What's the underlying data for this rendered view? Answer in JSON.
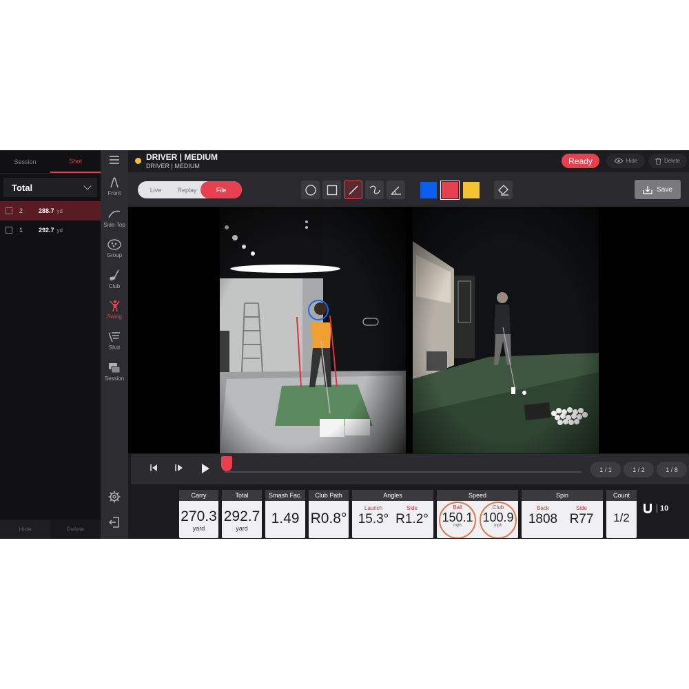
{
  "left_panel": {
    "tabs": [
      "Session",
      "Shot"
    ],
    "active_tab": "Shot",
    "filter": "Total",
    "shots": [
      {
        "num": "2",
        "value": "288.7",
        "unit": "yd",
        "selected": true
      },
      {
        "num": "1",
        "value": "292.7",
        "unit": "yd",
        "selected": false
      }
    ],
    "hide_label": "Hide",
    "delete_label": "Delete"
  },
  "nav": {
    "items": [
      {
        "label": "Front",
        "icon": "front-view-icon"
      },
      {
        "label": "Side-Top",
        "icon": "side-top-view-icon"
      },
      {
        "label": "Group",
        "icon": "group-icon"
      },
      {
        "label": "Club",
        "icon": "club-icon"
      },
      {
        "label": "Swing",
        "icon": "swing-icon",
        "active": true
      },
      {
        "label": "Shot",
        "icon": "shot-icon"
      },
      {
        "label": "Session",
        "icon": "session-icon"
      }
    ]
  },
  "header": {
    "title": "DRIVER | MEDIUM",
    "subtitle": "DRIVER | MEDIUM",
    "status": "Ready",
    "hide_label": "Hide",
    "delete_label": "Delete"
  },
  "toolbar": {
    "modes": [
      "Live",
      "Replay",
      "File"
    ],
    "active_mode": "File",
    "tools": [
      "circle-tool-icon",
      "rectangle-tool-icon",
      "line-tool-icon",
      "curve-tool-icon",
      "angle-tool-icon",
      "eraser-icon"
    ],
    "active_tool": "line-tool-icon",
    "colors": [
      "#0a5ef0",
      "#e8404f",
      "#f3c230"
    ],
    "selected_color": "#e8404f",
    "save_label": "Save"
  },
  "timeline": {
    "pages": [
      "1 / 1",
      "1 / 2",
      "1 / 8"
    ]
  },
  "stats": {
    "carry": {
      "label": "Carry",
      "value": "270.3",
      "unit": "yard"
    },
    "total": {
      "label": "Total",
      "value": "292.7",
      "unit": "yard"
    },
    "smash": {
      "label": "Smash Fac.",
      "value": "1.49"
    },
    "club_path": {
      "label": "Club Path",
      "value": "R0.8°"
    },
    "angles": {
      "label": "Angles",
      "launch_label": "Launch",
      "launch": "15.3°",
      "side_label": "Side",
      "side": "R1.2°"
    },
    "speed": {
      "label": "Speed",
      "ball_label": "Ball",
      "ball": "150.1",
      "ball_unit": "mph",
      "club_label": "Club",
      "club": "100.9",
      "club_unit": "mph"
    },
    "spin": {
      "label": "Spin",
      "back_label": "Back",
      "back": "1808",
      "side_label": "Side",
      "side": "R77"
    },
    "count": {
      "label": "Count",
      "value": "1/2"
    }
  },
  "brand": {
    "text": "10",
    "icon": "uneekor-logo-icon"
  }
}
